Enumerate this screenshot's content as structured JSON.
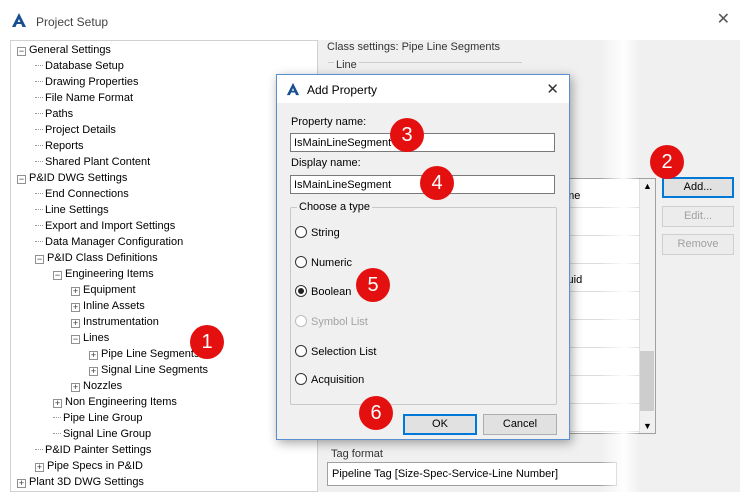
{
  "window": {
    "title": "Project Setup",
    "close_glyph": "✕"
  },
  "tree": {
    "items": [
      {
        "label": "General Settings",
        "level": 0,
        "expander": "−"
      },
      {
        "label": "Database Setup",
        "level": 1
      },
      {
        "label": "Drawing Properties",
        "level": 1
      },
      {
        "label": "File Name Format",
        "level": 1
      },
      {
        "label": "Paths",
        "level": 1
      },
      {
        "label": "Project Details",
        "level": 1
      },
      {
        "label": "Reports",
        "level": 1
      },
      {
        "label": "Shared Plant Content",
        "level": 1
      },
      {
        "label": "P&ID DWG Settings",
        "level": 0,
        "expander": "−"
      },
      {
        "label": "End Connections",
        "level": 1
      },
      {
        "label": "Line Settings",
        "level": 1
      },
      {
        "label": "Export and Import Settings",
        "level": 1
      },
      {
        "label": "Data Manager Configuration",
        "level": 1
      },
      {
        "label": "P&ID Class Definitions",
        "level": 1,
        "expander": "−"
      },
      {
        "label": "Engineering Items",
        "level": 2,
        "expander": "−"
      },
      {
        "label": "Equipment",
        "level": 3,
        "expander": "+"
      },
      {
        "label": "Inline Assets",
        "level": 3,
        "expander": "+"
      },
      {
        "label": "Instrumentation",
        "level": 3,
        "expander": "+"
      },
      {
        "label": "Lines",
        "level": 3,
        "expander": "−"
      },
      {
        "label": "Pipe Line Segments",
        "level": 4,
        "expander": "+"
      },
      {
        "label": "Signal Line Segments",
        "level": 4,
        "expander": "+"
      },
      {
        "label": "Nozzles",
        "level": 3,
        "expander": "+"
      },
      {
        "label": "Non Engineering Items",
        "level": 2,
        "expander": "+"
      },
      {
        "label": "Pipe Line Group",
        "level": 2
      },
      {
        "label": "Signal Line Group",
        "level": 2
      },
      {
        "label": "P&ID Painter Settings",
        "level": 1
      },
      {
        "label": "Pipe Specs in P&ID",
        "level": 1,
        "expander": "+"
      },
      {
        "label": "Plant 3D DWG Settings",
        "level": 0,
        "expander": "+"
      }
    ]
  },
  "right_panel": {
    "class_settings_label": "Class settings: Pipe Line Segments",
    "line_label": "Line",
    "grid_rows": [
      "ame",
      "",
      "",
      "Guid",
      "",
      "",
      "",
      "",
      ""
    ],
    "buttons": {
      "add": "Add...",
      "edit": "Edit...",
      "remove": "Remove"
    },
    "tag_format_label": "Tag format",
    "tag_format_value": "Pipeline Tag [Size-Spec-Service-Line Number]"
  },
  "dialog": {
    "title": "Add Property",
    "close_glyph": "✕",
    "property_name_label": "Property name:",
    "property_name_value": "IsMainLineSegment",
    "display_name_label": "Display name:",
    "display_name_value": "IsMainLineSegment",
    "choose_type_label": "Choose a type",
    "types": [
      {
        "label": "String",
        "selected": false,
        "enabled": true
      },
      {
        "label": "Numeric",
        "selected": false,
        "enabled": true
      },
      {
        "label": "Boolean",
        "selected": true,
        "enabled": true
      },
      {
        "label": "Symbol List",
        "selected": false,
        "enabled": false
      },
      {
        "label": "Selection List",
        "selected": false,
        "enabled": true
      },
      {
        "label": "Acquisition",
        "selected": false,
        "enabled": true
      }
    ],
    "ok_label": "OK",
    "cancel_label": "Cancel"
  },
  "callouts": [
    "1",
    "2",
    "3",
    "4",
    "5",
    "6"
  ],
  "colors": {
    "callout": "#e41010",
    "accent": "#0078d7",
    "logo": "#1a4f8f"
  }
}
